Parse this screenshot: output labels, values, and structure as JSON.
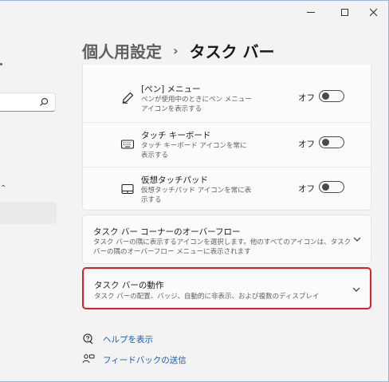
{
  "header": {
    "parent": "個人用設定",
    "separator": "›",
    "current": "タスク バー"
  },
  "pen_items": [
    {
      "icon": "pen-icon",
      "title": "[ペン] メニュー",
      "desc": "ペンが使用中のときにペン メニュー アイコンを表示する",
      "toggle_label": "オフ",
      "toggle_on": false
    },
    {
      "icon": "keyboard-icon",
      "title": "タッチ キーボード",
      "desc": "タッチ キーボード アイコンを常に表示する",
      "toggle_label": "オフ",
      "toggle_on": false
    },
    {
      "icon": "touchpad-icon",
      "title": "仮想タッチパッド",
      "desc": "仮想タッチパッド アイコンを常に表示する",
      "toggle_label": "オフ",
      "toggle_on": false
    }
  ],
  "cards": [
    {
      "title": "タスク バー コーナーのオーバーフロー",
      "desc": "タスク バーの隅に表示するアイコンを選択します。他のすべてのアイコンは、タスク バーの隅のオーバーフロー メニューに表示されます"
    },
    {
      "title": "タスク バーの動作",
      "desc": "タスク バーの配置、バッジ、自動的に非表示、および複数のディスプレイ"
    }
  ],
  "links": [
    {
      "icon": "help-icon",
      "text": "ヘルプを表示"
    },
    {
      "icon": "feedback-icon",
      "text": "フィードバックの送信"
    }
  ],
  "colors": {
    "highlight": "#d7222a",
    "link": "#1a5fb4"
  }
}
